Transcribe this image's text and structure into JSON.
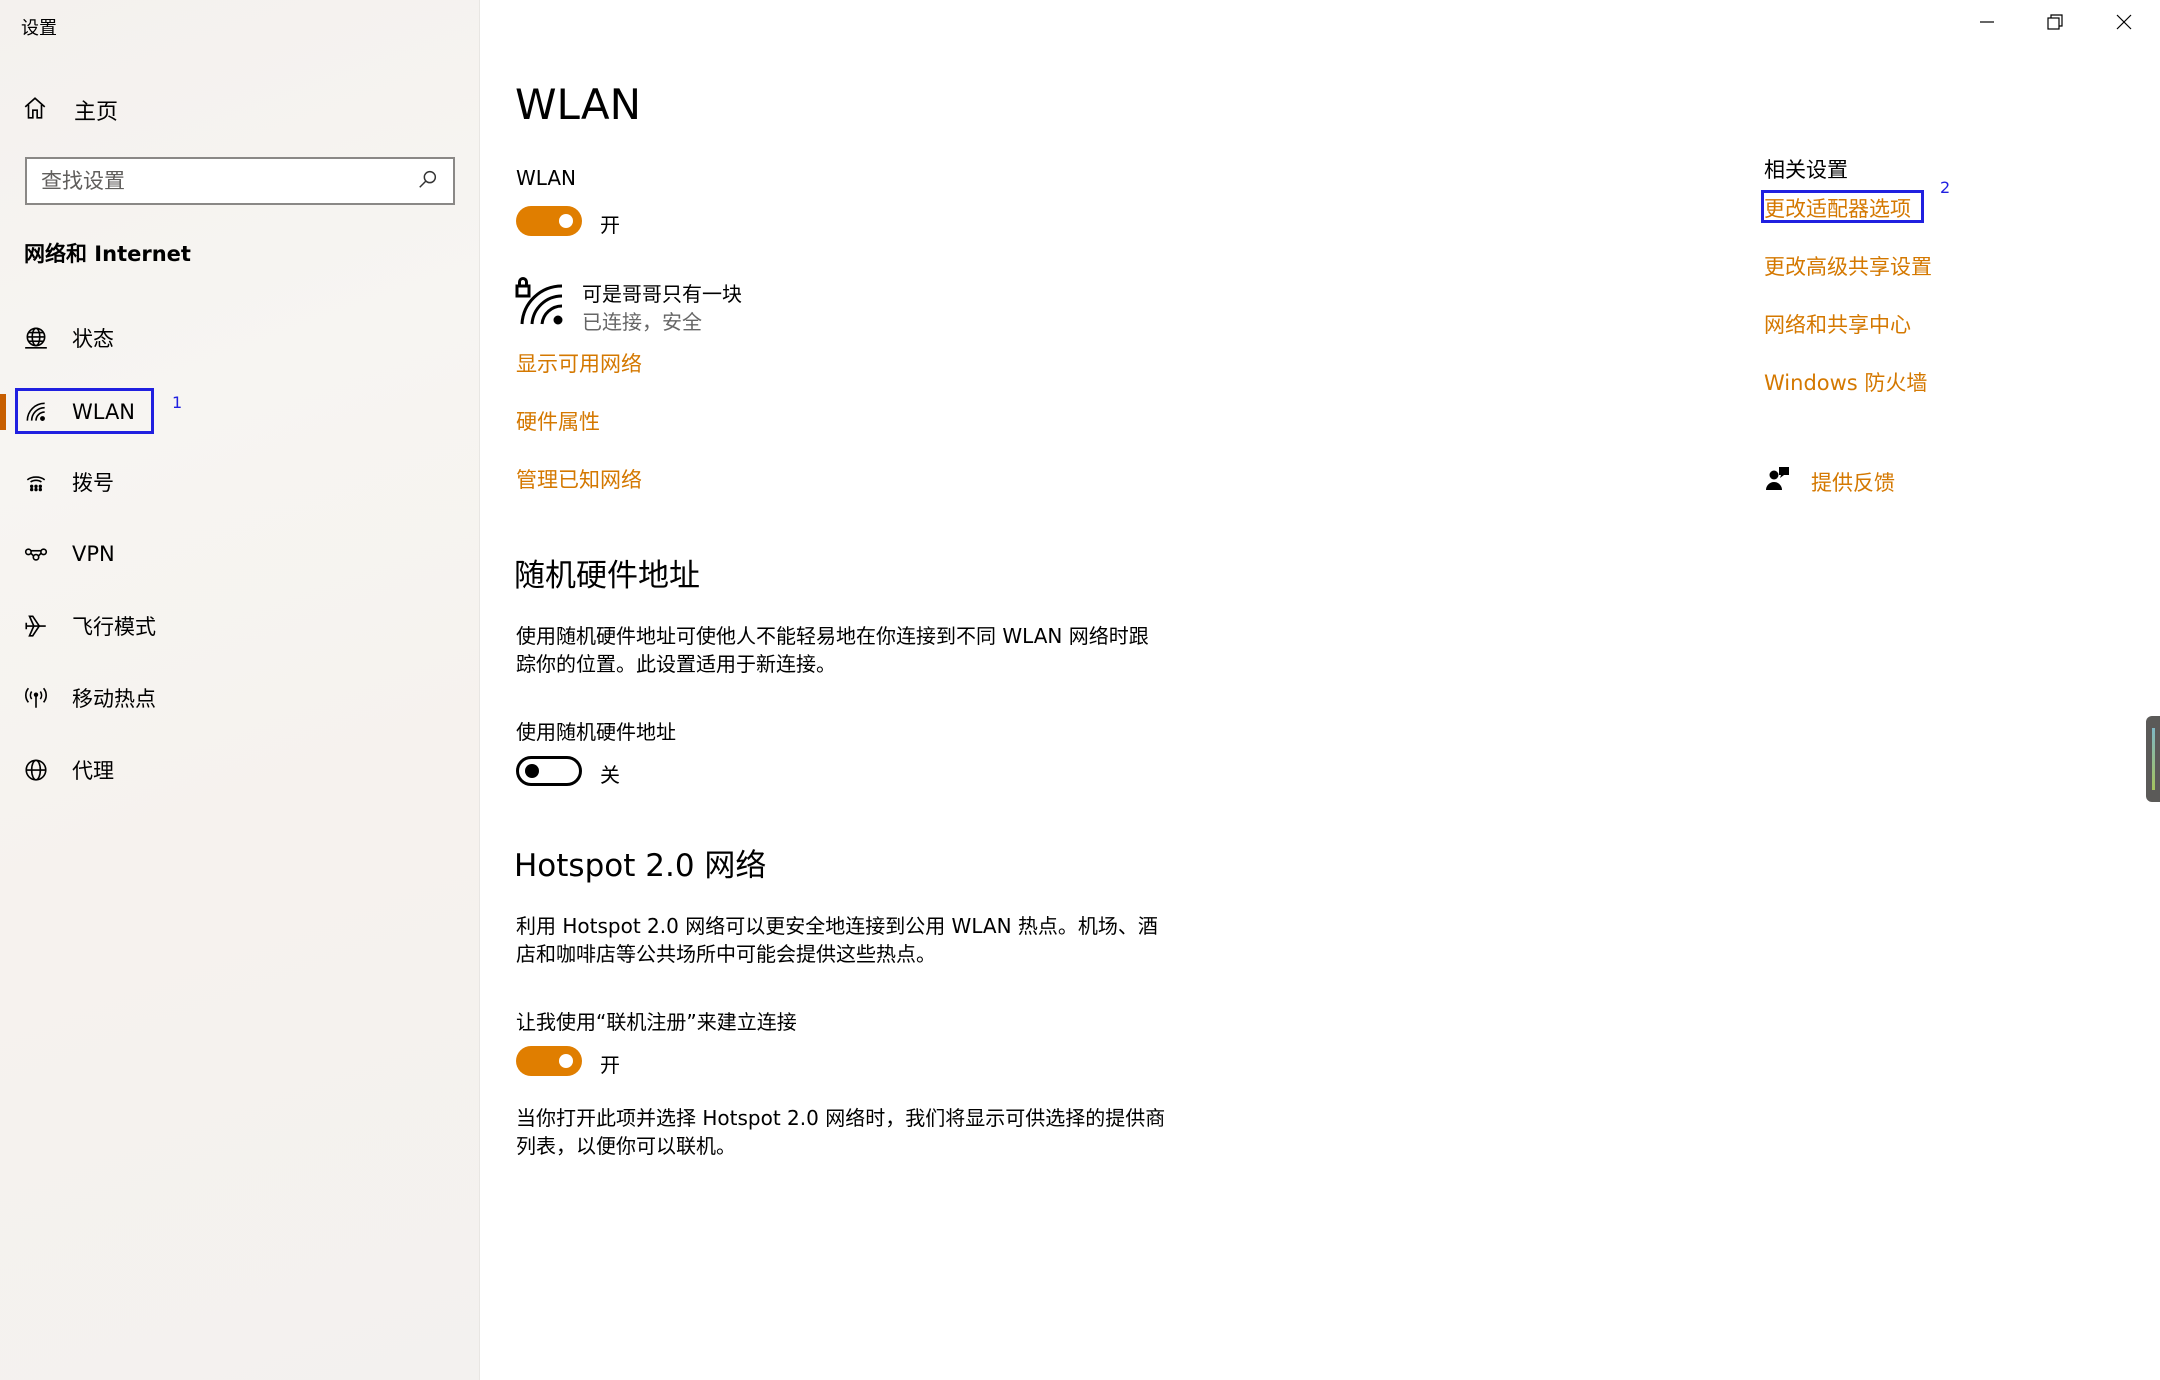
{
  "window": {
    "title": "设置"
  },
  "sidebar": {
    "home_label": "主页",
    "search_placeholder": "查找设置",
    "section_title": "网络和 Internet",
    "items": [
      {
        "label": "状态",
        "icon": "globe-status-icon"
      },
      {
        "label": "WLAN",
        "icon": "wifi-icon",
        "active": true,
        "marker": "1"
      },
      {
        "label": "拨号",
        "icon": "dialup-icon"
      },
      {
        "label": "VPN",
        "icon": "vpn-icon"
      },
      {
        "label": "飞行模式",
        "icon": "airplane-icon"
      },
      {
        "label": "移动热点",
        "icon": "hotspot-icon"
      },
      {
        "label": "代理",
        "icon": "proxy-globe-icon"
      }
    ]
  },
  "main": {
    "title": "WLAN",
    "wlan": {
      "label": "WLAN",
      "state": "开"
    },
    "network": {
      "name": "可是哥哥只有一块",
      "status": "已连接，安全"
    },
    "links": {
      "show_available": "显示可用网络",
      "hardware_props": "硬件属性",
      "manage_known": "管理已知网络"
    },
    "random_mac": {
      "heading": "随机硬件地址",
      "description_line1": "使用随机硬件地址可使他人不能轻易地在你连接到不同 WLAN 网络时跟",
      "description_line2": "踪你的位置。此设置适用于新连接。",
      "toggle_label": "使用随机硬件地址",
      "state": "关"
    },
    "hotspot20": {
      "heading": "Hotspot 2.0 网络",
      "description_line1": "利用 Hotspot 2.0 网络可以更安全地连接到公用 WLAN 热点。机场、酒",
      "description_line2": "店和咖啡店等公共场所中可能会提供这些热点。",
      "toggle_label": "让我使用“联机注册”来建立连接",
      "state": "开",
      "note_line1": "当你打开此项并选择 Hotspot 2.0 网络时，我们将显示可供选择的提供商",
      "note_line2": "列表，以便你可以联机。"
    }
  },
  "related": {
    "title": "相关设置",
    "links": [
      {
        "label": "更改适配器选项",
        "marker": "2"
      },
      {
        "label": "更改高级共享设置"
      },
      {
        "label": "网络和共享中心"
      },
      {
        "label": "Windows 防火墙"
      }
    ],
    "feedback_label": "提供反馈"
  },
  "colors": {
    "accent": "#e07e00",
    "link": "#d47800",
    "highlight_box": "#2020e0"
  }
}
